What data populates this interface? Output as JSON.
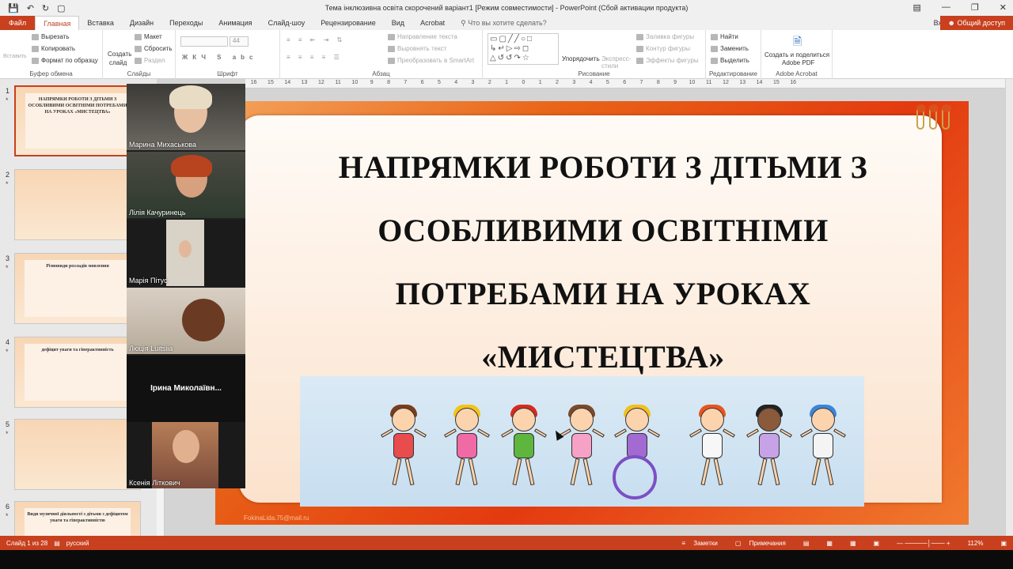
{
  "window": {
    "title": "Тема інклюзивна освіта скорочений варіант1 [Режим совместимости] - PowerPoint (Сбой активации продукта)"
  },
  "qat": {
    "save_icon": "save-icon",
    "undo_icon": "undo-icon",
    "redo_icon": "redo-icon"
  },
  "tabs": [
    {
      "label": "Файл"
    },
    {
      "label": "Главная"
    },
    {
      "label": "Вставка"
    },
    {
      "label": "Дизайн"
    },
    {
      "label": "Переходы"
    },
    {
      "label": "Анимация"
    },
    {
      "label": "Слайд-шоу"
    },
    {
      "label": "Рецензирование"
    },
    {
      "label": "Вид"
    },
    {
      "label": "Acrobat"
    }
  ],
  "tell_me": "Что вы хотите сделать?",
  "login": "Вход",
  "share": "Общий доступ",
  "ribbon": {
    "clipboard": {
      "paste": "Вставить",
      "cut": "Вырезать",
      "copy": "Копировать",
      "format": "Формат по образцу",
      "label": "Буфер обмена"
    },
    "slides": {
      "new": "Создать",
      "new2": "слайд",
      "layout": "Макет",
      "reset": "Сбросить",
      "section": "Раздел",
      "label": "Слайды"
    },
    "font": {
      "size": "44",
      "label": "Шрифт"
    },
    "paragraph": {
      "direction": "Направление текста",
      "align": "Выровнять текст",
      "smartart": "Преобразовать в SmartArt",
      "label": "Абзац"
    },
    "drawing": {
      "arrange": "Упорядочить",
      "styles": "Экспресс-стили",
      "fill": "Заливка фигуры",
      "outline": "Контур фигуры",
      "effects": "Эффекты фигуры",
      "label": "Рисование"
    },
    "editing": {
      "find": "Найти",
      "replace": "Заменить",
      "select": "Выделить",
      "label": "Редактирование"
    },
    "acrobat": {
      "create": "Создать и поделиться",
      "create2": "Adobe PDF",
      "label": "Adobe Acrobat"
    }
  },
  "ruler": [
    "16",
    "15",
    "14",
    "13",
    "12",
    "11",
    "10",
    "9",
    "8",
    "7",
    "6",
    "5",
    "4",
    "3",
    "2",
    "1",
    "0",
    "1",
    "2",
    "3",
    "4",
    "5",
    "6",
    "7",
    "8",
    "9",
    "10",
    "11",
    "12",
    "13",
    "14",
    "15",
    "16"
  ],
  "thumbnails": [
    {
      "num": "1",
      "title": "НАПРЯМКИ РОБОТИ З ДІТЬМИ З ОСОБЛИВИМИ ОСВІТНІМИ ПОТРЕБАМИ НА УРОКАХ «МИСТЕЦТВА»"
    },
    {
      "num": "2",
      "title": ""
    },
    {
      "num": "3",
      "title": "Різновиди розладів мовлення"
    },
    {
      "num": "4",
      "title": "дефіцит уваги та гіперактивність"
    },
    {
      "num": "5",
      "title": ""
    },
    {
      "num": "6",
      "title": "Види музичної діяльності з дітьми з дефіцитом уваги та гіперактивністю"
    }
  ],
  "participants": [
    {
      "name": "Марина Михаськова"
    },
    {
      "name": "Лілія Качуринець"
    },
    {
      "name": "Марія Пітус"
    },
    {
      "name": "Люція Luitsiia"
    },
    {
      "name": "Ірина  Миколаївн..."
    },
    {
      "name": "Ксенія Літкович"
    }
  ],
  "slide": {
    "title_lines": [
      "НАПРЯМКИ РОБОТИ З ДІТЬМИ З",
      "ОСОБЛИВИМИ ОСВІТНІМИ",
      "ПОТРЕБАМИ НА УРОКАХ",
      "«МИСТЕЦТВА»"
    ],
    "watermark": "FokinaLida.75@mail.ru"
  },
  "status": {
    "slide": "Слайд 1 из 28",
    "language": "русский",
    "notes": "Заметки",
    "comments": "Примечания",
    "zoom": "112%"
  }
}
